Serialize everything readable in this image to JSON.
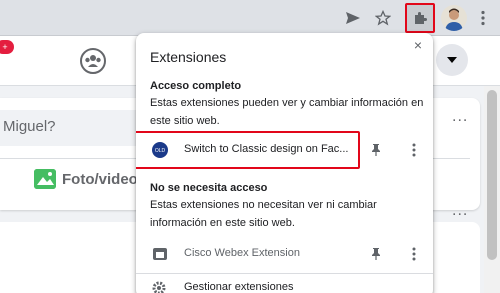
{
  "toolbar": {
    "icons": [
      "send-icon",
      "bookmark-star-icon",
      "extensions-puzzle-icon",
      "profile-avatar",
      "chrome-menu-icon"
    ]
  },
  "facebook": {
    "notification_count": "+",
    "composer_placeholder": "Miguel?",
    "photo_video_label": "Foto/video",
    "more_label": "..."
  },
  "extensions_popup": {
    "title": "Extensiones",
    "close_label": "×",
    "full_access": {
      "heading": "Acceso completo",
      "description": "Estas extensiones pueden ver y cambiar información en este sitio web.",
      "items": [
        {
          "name": "Switch to Classic design on Fac...",
          "icon": "classic-design-icon",
          "icon_text": "OLD"
        }
      ]
    },
    "no_access": {
      "heading": "No se necesita acceso",
      "description": "Estas extensiones no necesitan ver ni cambiar información en este sitio web.",
      "items": [
        {
          "name": "Cisco Webex Extension",
          "icon": "webex-icon"
        }
      ]
    },
    "manage_label": "Gestionar extensiones"
  },
  "colors": {
    "highlight": "#e2071a",
    "chrome_toolbar": "#dee1e6",
    "fb_background": "#f0f2f5",
    "photo_green": "#45bd62"
  }
}
